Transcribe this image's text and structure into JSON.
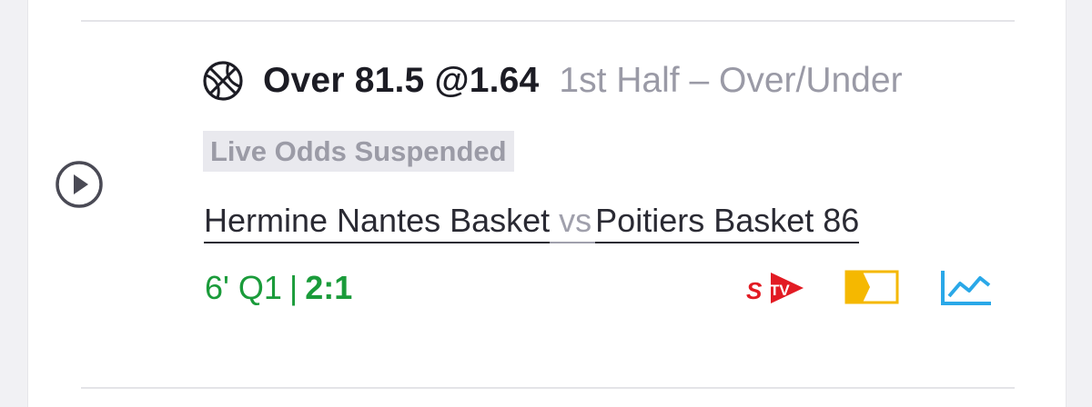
{
  "bet": {
    "selection": "Over 81.5 @1.64",
    "market": "1st Half – Over/Under",
    "status_badge": "Live Odds Suspended"
  },
  "match": {
    "home_team": "Hermine Nantes Basket",
    "separator": "vs",
    "away_team": "Poitiers Basket 86"
  },
  "live": {
    "time": "6' Q1",
    "separator": "|",
    "score": "2:1"
  },
  "icons": {
    "sport": "basketball-icon",
    "play": "play-circle-icon",
    "stream": "stv-icon",
    "video": "video-icon",
    "stats": "stats-chart-icon"
  },
  "colors": {
    "live_green": "#1a9b3a",
    "stv_red": "#e21b23",
    "video_yellow": "#f5b800",
    "stats_blue": "#2aa8e8",
    "muted_text": "#9a9aa6"
  }
}
